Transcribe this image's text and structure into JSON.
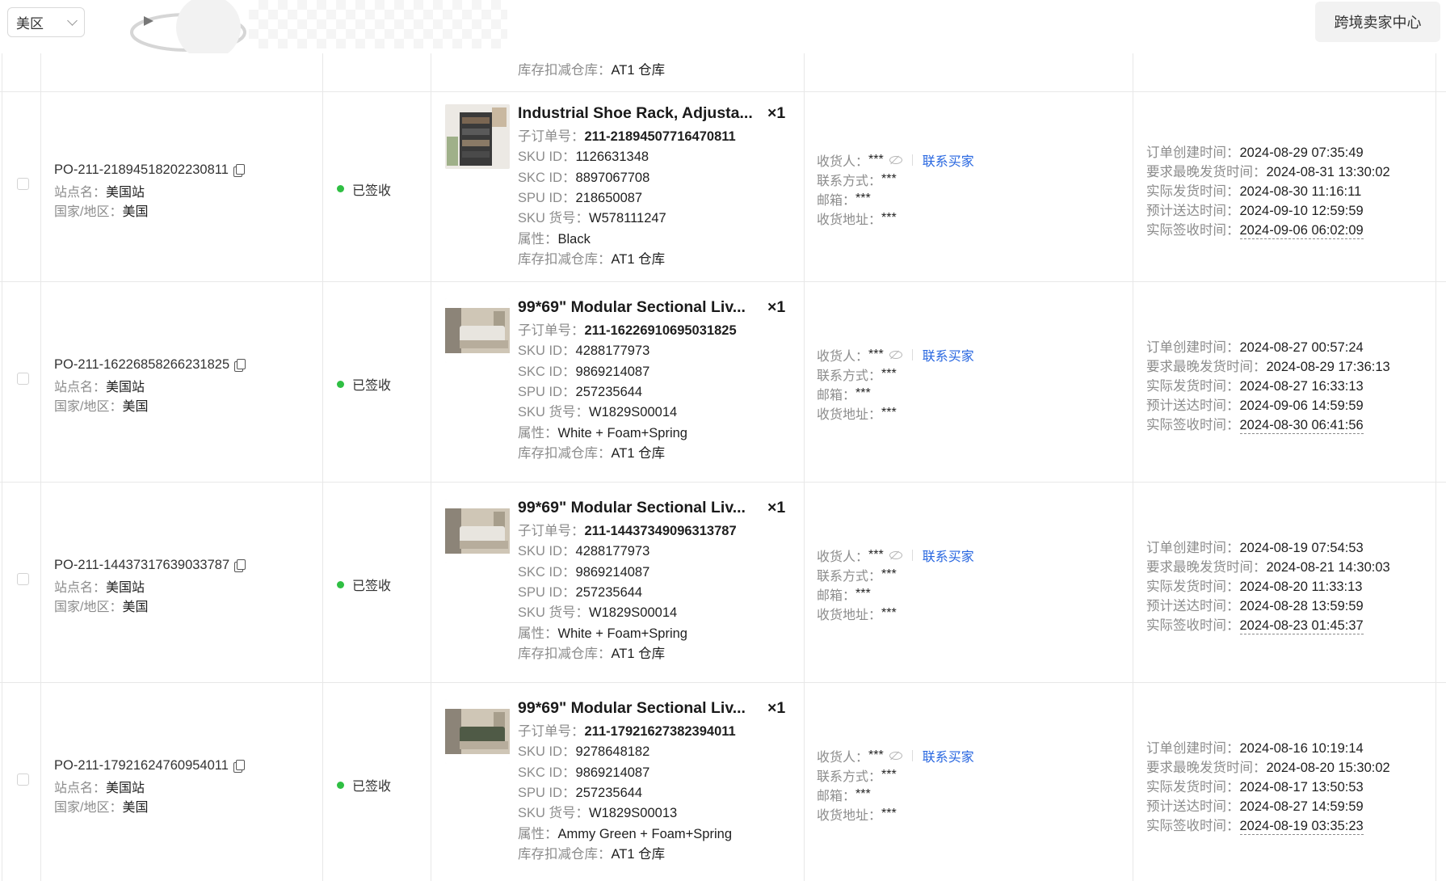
{
  "header": {
    "region_select": "美区",
    "seller_center": "跨境卖家中心"
  },
  "labels": {
    "site": "站点名：",
    "country": "国家/地区：",
    "sub_order": "子订单号：",
    "sku_id": "SKU ID：",
    "skc_id": "SKC ID：",
    "spu_id": "SPU ID：",
    "sku_code": "SKU 货号：",
    "attr": "属性：",
    "warehouse": "库存扣减仓库：",
    "receiver": "收货人：",
    "contact": "联系方式：",
    "email": "邮箱：",
    "address": "收货地址：",
    "contact_buyer": "联系买家",
    "created": "订单创建时间：",
    "latest_ship": "要求最晚发货时间：",
    "actual_ship": "实际发货时间：",
    "eta": "预计送达时间：",
    "signed": "实际签收时间："
  },
  "partial_row": {
    "warehouse": "AT1 仓库"
  },
  "rows": [
    {
      "order_id": "PO-211-21894518202230811",
      "site": "美国站",
      "country": "美国",
      "status": "已签收",
      "title": "Industrial Shoe Rack, Adjusta...",
      "qty": "×1",
      "sub_order": "211-21894507716470811",
      "sku_id": "1126631348",
      "skc_id": "8897067708",
      "spu_id": "218650087",
      "sku_code": "W578111247",
      "attr": "Black",
      "warehouse": "AT1 仓库",
      "receiver": "***",
      "contact": "***",
      "email": "***",
      "address": "***",
      "created": "2024-08-29 07:35:49",
      "latest_ship": "2024-08-31 13:30:02",
      "actual_ship": "2024-08-30 11:16:11",
      "eta": "2024-09-10 12:59:59",
      "signed": "2024-09-06 06:02:09"
    },
    {
      "order_id": "PO-211-16226858266231825",
      "site": "美国站",
      "country": "美国",
      "status": "已签收",
      "title": "99*69\" Modular Sectional Liv...",
      "qty": "×1",
      "sub_order": "211-16226910695031825",
      "sku_id": "4288177973",
      "skc_id": "9869214087",
      "spu_id": "257235644",
      "sku_code": "W1829S00014",
      "attr": "White + Foam+Spring",
      "warehouse": "AT1 仓库",
      "receiver": "***",
      "contact": "***",
      "email": "***",
      "address": "***",
      "created": "2024-08-27 00:57:24",
      "latest_ship": "2024-08-29 17:36:13",
      "actual_ship": "2024-08-27 16:33:13",
      "eta": "2024-09-06 14:59:59",
      "signed": "2024-08-30 06:41:56"
    },
    {
      "order_id": "PO-211-14437317639033787",
      "site": "美国站",
      "country": "美国",
      "status": "已签收",
      "title": "99*69\" Modular Sectional Liv...",
      "qty": "×1",
      "sub_order": "211-14437349096313787",
      "sku_id": "4288177973",
      "skc_id": "9869214087",
      "spu_id": "257235644",
      "sku_code": "W1829S00014",
      "attr": "White + Foam+Spring",
      "warehouse": "AT1 仓库",
      "receiver": "***",
      "contact": "***",
      "email": "***",
      "address": "***",
      "created": "2024-08-19 07:54:53",
      "latest_ship": "2024-08-21 14:30:03",
      "actual_ship": "2024-08-20 11:33:13",
      "eta": "2024-08-28 13:59:59",
      "signed": "2024-08-23 01:45:37"
    },
    {
      "order_id": "PO-211-17921624760954011",
      "site": "美国站",
      "country": "美国",
      "status": "已签收",
      "title": "99*69\" Modular Sectional Liv...",
      "qty": "×1",
      "sub_order": "211-17921627382394011",
      "sku_id": "9278648182",
      "skc_id": "9869214087",
      "spu_id": "257235644",
      "sku_code": "W1829S00013",
      "attr": "Ammy Green + Foam+Spring",
      "warehouse": "AT1 仓库",
      "receiver": "***",
      "contact": "***",
      "email": "***",
      "address": "***",
      "created": "2024-08-16 10:19:14",
      "latest_ship": "2024-08-20 15:30:02",
      "actual_ship": "2024-08-17 13:50:53",
      "eta": "2024-08-27 14:59:59",
      "signed": "2024-08-19 03:35:23"
    }
  ],
  "colors": {
    "status_green": "#2fbf43",
    "link_blue": "#2766e0",
    "border": "#e8e8e8",
    "label_gray": "#8c8c8c"
  },
  "icons": [
    "chevron-down-icon",
    "copy-icon",
    "eye-off-icon",
    "status-dot"
  ]
}
